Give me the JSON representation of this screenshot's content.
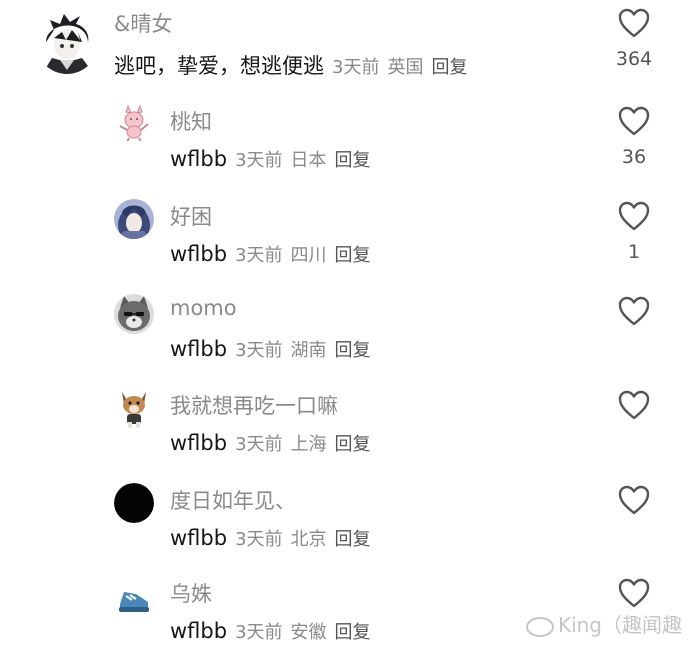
{
  "comments": [
    {
      "user": "&晴女",
      "text": "逃吧，挚爱，想逃便逃",
      "time": "3天前",
      "location": "英国",
      "reply": "回复",
      "likes": "364"
    },
    {
      "user": "桃知",
      "text": "wflbb",
      "time": "3天前",
      "location": "日本",
      "reply": "回复",
      "likes": "36"
    },
    {
      "user": "好困",
      "text": "wflbb",
      "time": "3天前",
      "location": "四川",
      "reply": "回复",
      "likes": "1"
    },
    {
      "user": "momo",
      "text": "wflbb",
      "time": "3天前",
      "location": "湖南",
      "reply": "回复",
      "likes": ""
    },
    {
      "user": "我就想再吃一口嘛",
      "text": "wflbb",
      "time": "3天前",
      "location": "上海",
      "reply": "回复",
      "likes": ""
    },
    {
      "user": "度日如年见、",
      "text": "wflbb",
      "time": "3天前",
      "location": "北京",
      "reply": "回复",
      "likes": ""
    },
    {
      "user": "乌姝",
      "text": "wflbb",
      "time": "3天前",
      "location": "安徽",
      "reply": "回复",
      "likes": ""
    }
  ],
  "watermark": "King（趣闻趣",
  "icons": {
    "like": "heart-outline-icon",
    "watermark": "weibo-logo-icon"
  }
}
